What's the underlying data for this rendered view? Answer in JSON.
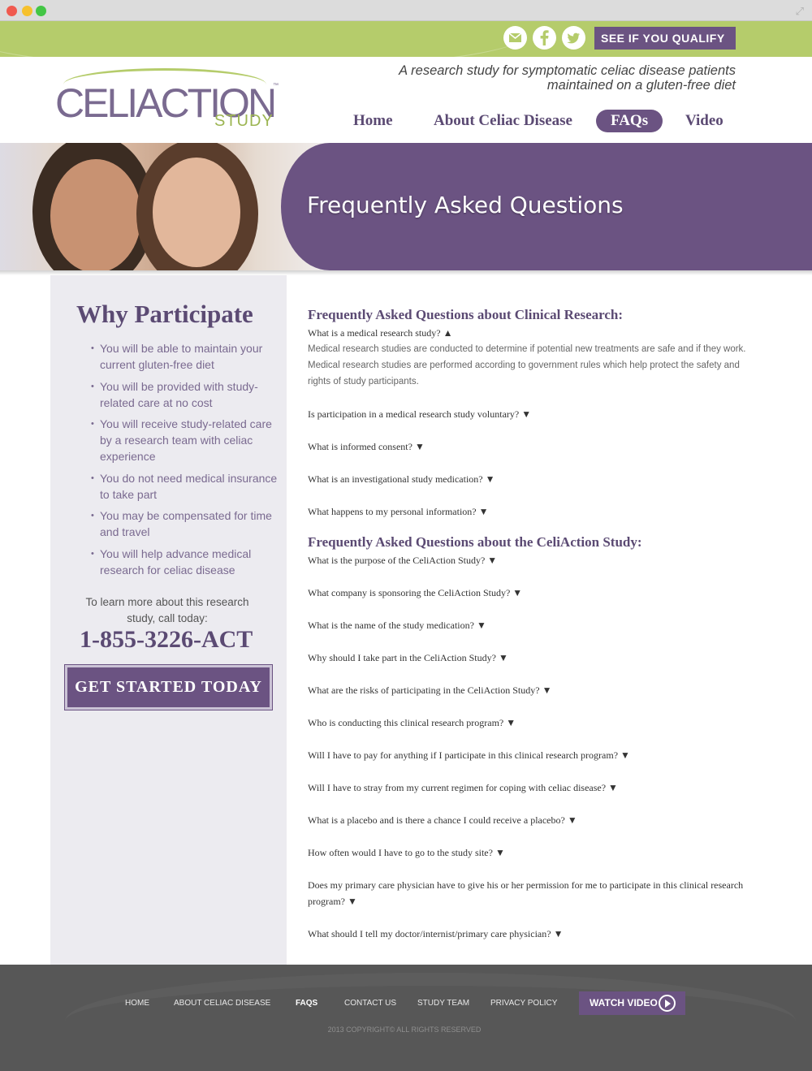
{
  "topbar": {
    "qualify_label": "SEE IF YOU QUALIFY ▶",
    "icons": [
      "email-icon",
      "facebook-icon",
      "twitter-icon"
    ]
  },
  "header": {
    "logo_main": "CELIACTION",
    "logo_sub": "STUDY",
    "logo_tm": "™",
    "tagline_line1": "A research study for symptomatic celiac disease patients",
    "tagline_line2": "maintained on a gluten-free diet",
    "nav": [
      "Home",
      "About Celiac Disease",
      "FAQs",
      "Video"
    ],
    "active_nav": "FAQs"
  },
  "banner": {
    "title": "Frequently Asked Questions"
  },
  "sidebar": {
    "title": "Why Participate",
    "items": [
      "You will be able to maintain your current gluten-free diet",
      "You will be provided with study-related care at no cost",
      "You will receive study-related care by a research team with celiac experience",
      "You do not need medical insurance to take part",
      "You may be compensated for time and travel",
      "You will help advance medical research for celiac disease"
    ],
    "learn_more": "To learn more about this research study, call today:",
    "phone": "1-855-3226-ACT",
    "cta": "GET STARTED TODAY"
  },
  "faq": {
    "section1_title": "Frequently Asked Questions about Clinical Research:",
    "section1": [
      {
        "q": "What is a medical research study? ▲",
        "expanded": true,
        "a": "Medical research studies are conducted to determine if potential new treatments are safe and if they work. Medical research studies are performed according to government rules which help protect the safety and rights of study participants."
      },
      {
        "q": "Is participation in a medical research study voluntary? ▼"
      },
      {
        "q": "What is informed consent? ▼"
      },
      {
        "q": "What is an investigational study medication? ▼"
      },
      {
        "q": "What happens to my personal information? ▼"
      }
    ],
    "section2_title": "Frequently Asked Questions about the CeliAction Study:",
    "section2": [
      {
        "q": "What is the purpose of the CeliAction Study? ▼"
      },
      {
        "q": "What company is sponsoring the CeliAction Study? ▼"
      },
      {
        "q": "What is the name of the study medication? ▼"
      },
      {
        "q": "Why should I take part in the CeliAction Study? ▼"
      },
      {
        "q": "What are the risks of participating in the CeliAction Study? ▼"
      },
      {
        "q": "Who is conducting this clinical research program? ▼"
      },
      {
        "q": "Will I have to pay for anything if I participate in this clinical research program? ▼"
      },
      {
        "q": "Will I have to stray from my current regimen for coping with celiac disease? ▼"
      },
      {
        "q": "What is a placebo and is there a chance I could receive a placebo? ▼"
      },
      {
        "q": "How often would I have to go to the study site? ▼"
      },
      {
        "q": "Does my primary care physician have to give his or her permission for me to participate in this clinical research program? ▼"
      },
      {
        "q": "What should I tell my doctor/internist/primary care physician? ▼"
      }
    ]
  },
  "footer": {
    "nav": [
      "HOME",
      "ABOUT CELIAC DISEASE",
      "FAQS",
      "CONTACT US",
      "STUDY TEAM",
      "PRIVACY POLICY"
    ],
    "active": "FAQS",
    "watch_label": "WATCH VIDEO",
    "copyright": "2013 COPYRIGHT© ALL RIGHTS RESERVED"
  },
  "colors": {
    "brand_purple": "#6b5382",
    "brand_green": "#b5cc6b",
    "sidebar_bg": "#ecebf0",
    "footer_bg": "#575757"
  }
}
